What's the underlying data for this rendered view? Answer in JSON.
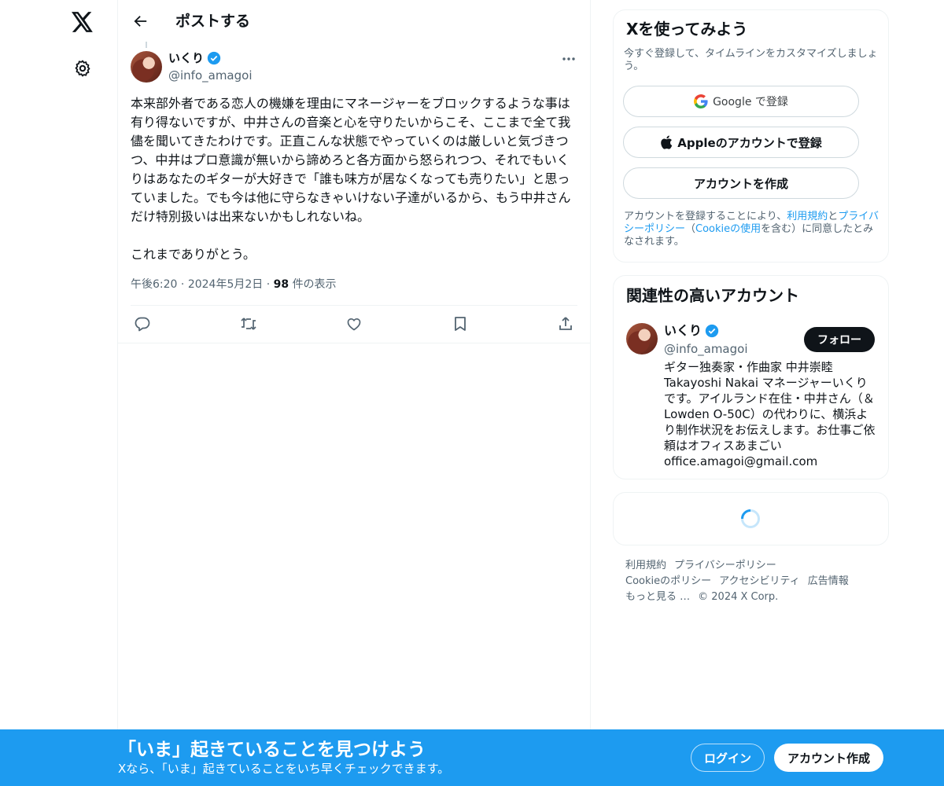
{
  "nav": {
    "logo_icon": "x-logo-icon",
    "settings_icon": "gear-icon"
  },
  "header": {
    "back_icon": "arrow-left-icon",
    "title": "ポストする"
  },
  "post": {
    "author_name": "いくり",
    "author_handle": "@info_amagoi",
    "verified": true,
    "text": "本来部外者である恋人の機嫌を理由にマネージャーをブロックするような事は有り得ないですが、中井さんの音楽と心を守りたいからこそ、ここまで全て我儘を聞いてきたわけです。正直こんな状態でやっていくのは厳しいと気づきつつ、中井はプロ意識が無いから諦めろと各方面から怒られつつ、それでもいくりはあなたのギターが大好きで「誰も味方が居なくなっても売りたい」と思っていました。でも今は他に守らなきゃいけない子達がいるから、もう中井さんだけ特別扱いは出来ないかもしれないね。\n\nこれまでありがとう。",
    "time": "午後6:20",
    "date": "2024年5月2日",
    "views_count": "98",
    "views_label": "件の表示",
    "actions": [
      "reply-icon",
      "repost-icon",
      "like-icon",
      "bookmark-icon",
      "share-icon"
    ]
  },
  "signup_card": {
    "title": "Xを使ってみよう",
    "subtitle": "今すぐ登録して、タイムラインをカスタマイズしましょう。",
    "google_label": "Google で登録",
    "apple_label": "Appleのアカウントで登録",
    "create_label": "アカウントを作成",
    "legal_prefix": "アカウントを登録することにより、",
    "legal_terms": "利用規約",
    "legal_and": "と",
    "legal_privacy": "プライバシーポリシー",
    "legal_paren_open": "（",
    "legal_cookie": "Cookieの使用",
    "legal_suffix": "を含む）に同意したとみなされます。"
  },
  "related_card": {
    "title": "関連性の高いアカウント",
    "name": "いくり",
    "handle": "@info_amagoi",
    "follow_label": "フォロー",
    "bio": "ギター独奏家・作曲家 中井崇睦 Takayoshi Nakai マネージャーいくりです。アイルランド在住・中井さん（＆Lowden O-50C）の代わりに、横浜より制作状況をお伝えします。お仕事ご依頼はオフィスあまごい office.amagoi@gmail.com"
  },
  "footer": {
    "terms": "利用規約",
    "privacy": "プライバシーポリシー",
    "cookie": "Cookieのポリシー",
    "accessibility": "アクセシビリティ",
    "ads": "広告情報",
    "more": "もっと見る …",
    "copyright": "© 2024 X Corp."
  },
  "bottom_bar": {
    "title": "「いま」起きていることを見つけよう",
    "subtitle": "Xなら、「いま」起きていることをいち早くチェックできます。",
    "login_label": "ログイン",
    "signup_label": "アカウント作成"
  },
  "colors": {
    "accent": "#1d9bf0",
    "text": "#0f1419",
    "muted": "#536471"
  }
}
